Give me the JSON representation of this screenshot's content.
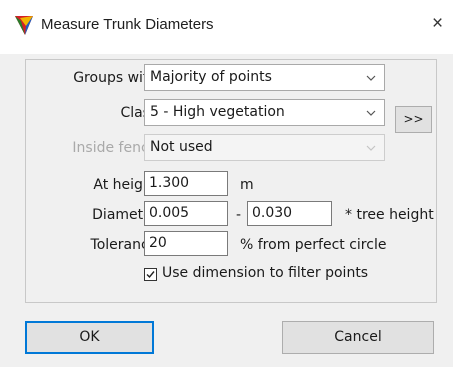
{
  "window": {
    "title": "Measure Trunk Diameters",
    "close_glyph": "×",
    "icon": "tree-icon"
  },
  "form": {
    "groups_with": {
      "label": "Groups with:",
      "value": "Majority of points"
    },
    "class": {
      "label": "Class:",
      "value": "5 - High vegetation",
      "more_button": ">>"
    },
    "inside_fence": {
      "label": "Inside fence:",
      "value": "Not used",
      "enabled": false
    },
    "at_height": {
      "label": "At height:",
      "value": "1.300",
      "unit": "m"
    },
    "diameter": {
      "label": "Diameter:",
      "min": "0.005",
      "separator": "-",
      "max": "0.030",
      "unit": "* tree height"
    },
    "tolerance": {
      "label": "Tolerance:",
      "value": "20",
      "unit": "% from perfect circle"
    },
    "use_dimension": {
      "label": "Use dimension to filter points",
      "checked": true
    }
  },
  "buttons": {
    "ok": "OK",
    "cancel": "Cancel"
  }
}
